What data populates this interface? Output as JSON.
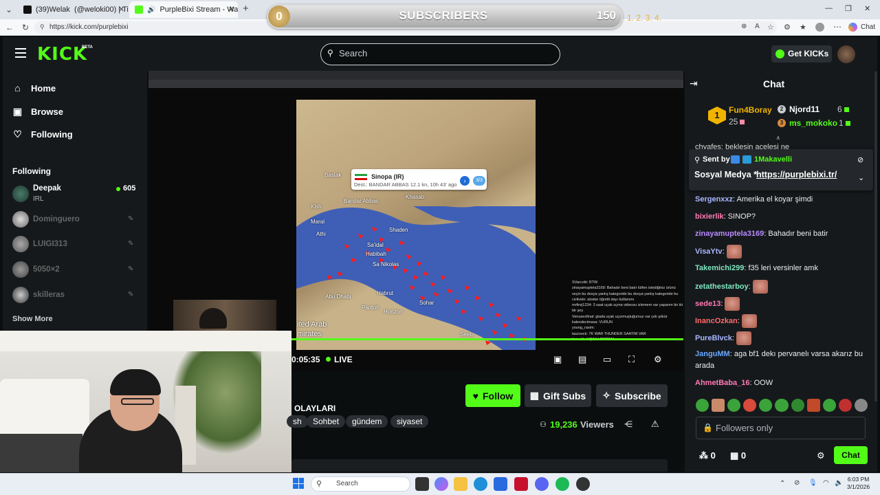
{
  "browser": {
    "tabs": [
      {
        "label": "(39)Welak",
        "label2": "(@weloki00) | TikTok"
      },
      {
        "label": "PurpleBixi Stream - Watch Live"
      }
    ],
    "url": "https://kick.com/purplebixi",
    "chat_label": "Chat"
  },
  "overlay": {
    "current": "0",
    "title": "SUBSCRIBERS",
    "goal": "150",
    "steps": "1. 2.  3. 4."
  },
  "header": {
    "logo": "KICK",
    "beta": "BETA",
    "search_placeholder": "Search",
    "get_kicks": "Get KICKs"
  },
  "sidebar": {
    "nav": [
      {
        "label": "Home",
        "icon": "home-icon"
      },
      {
        "label": "Browse",
        "icon": "compass-icon"
      },
      {
        "label": "Following",
        "icon": "heart-icon"
      }
    ],
    "following_title": "Following",
    "channels": [
      {
        "name": "Deepak",
        "sub": "IRL",
        "viewers": "605",
        "live": true
      },
      {
        "name": "Dominguero",
        "live": false
      },
      {
        "name": "LUIGI313",
        "live": false
      },
      {
        "name": "5050×2",
        "live": false
      },
      {
        "name": "skilleras",
        "live": false
      }
    ],
    "show_more": "Show More"
  },
  "video": {
    "time": "0:05:35",
    "live_label": "LIVE",
    "tooltip_title": "Sinopa (IR)",
    "tooltip_sub": "Dest.: BANDAR ABBAS  12.1 kn, 10h 43' ago",
    "tooltip_badge": "3/3",
    "map_region": "ited Arab\nmirates",
    "map_labels": [
      "Maral",
      "Athi",
      "Shaden",
      "Habibah",
      "Sa'idal",
      "Sa Nikolas",
      "Abu Dhabi",
      "Parttoh",
      "Habrut",
      "Horizon",
      "Sohar",
      "Seeb",
      "Bandar Abbas",
      "Khasab",
      "Bastak",
      "Kish"
    ],
    "stream_chat": [
      "SVarcotti: BTW",
      "zinayamuptela3169: Bahadır beni batır lütfen istediğiniz ürünü seçin bu dosya yanlış kategoride bu dosya yanlış kategoride bu",
      "civilvele: aloske öğretti dayı kullanımı",
      "mrfirej1234: 3 saat uçak uçma videosu izlemem var yaparım bir iki bir şey",
      "Venusexfinal: gtada uçak uçurmuşluğumuz var çok şükür",
      "kalesdecimasa: VURUN",
      "young_rasim: ",
      "laszoock: 7K WAR THUNDER SAATIM VAR",
      "bixierlik: UÇAK VERİRIM"
    ]
  },
  "stream": {
    "title_fragment": "OLAYLARI",
    "tags": [
      "sh",
      "Sohbet",
      "gündem",
      "siyaset"
    ],
    "follow": "Follow",
    "gift_subs": "Gift Subs",
    "subscribe": "Subscribe",
    "viewers": "19,236",
    "viewers_label": "Viewers"
  },
  "chat": {
    "title": "Chat",
    "leaderboard": [
      {
        "rank": "1",
        "name": "Fun4Boray",
        "value": "25"
      },
      {
        "rank": "2",
        "name": "Njord11",
        "value": "6"
      },
      {
        "rank": "3",
        "name": "ms_mokoko",
        "value": "1"
      }
    ],
    "cut_line": "chyafes: beklesin acelesi ne",
    "pinned": {
      "sent_by": "Sent by",
      "user": "1Makavelli",
      "message": "Sosyal Medya *",
      "link": "https://purplebixi.tr/"
    },
    "messages": [
      {
        "user": "Sergenxxz",
        "text": "Amerika el koyar şimdi",
        "color": "#a8b6ff",
        "emote": false
      },
      {
        "user": "bixierlik",
        "text": "SINOP?",
        "color": "#ff7ab5",
        "emote": false
      },
      {
        "user": "zinayamuptela3169",
        "text": "Bahadır beni batir",
        "color": "#b98aff",
        "emote": false
      },
      {
        "user": "VisaYtv",
        "text": "",
        "color": "#a8b6ff",
        "emote": true
      },
      {
        "user": "Takemichi299",
        "text": "f35 leri versinler amk",
        "color": "#7ee8c0",
        "emote": false
      },
      {
        "user": "zetathestarboy",
        "text": "",
        "color": "#7ee8c0",
        "emote": true
      },
      {
        "user": "sede13",
        "text": "",
        "color": "#ff7ab5",
        "emote": true
      },
      {
        "user": "InancOzkan",
        "text": "",
        "color": "#ff6a6a",
        "emote": true
      },
      {
        "user": "PureBlvck",
        "text": "",
        "color": "#a8b6ff",
        "emote": true
      },
      {
        "user": "JanguMM",
        "text": "aga bf1 dekı pervanelı varsa akarız bu arada",
        "color": "#6aa8ff",
        "emote": false
      },
      {
        "user": "AhmetBaba_16",
        "text": "OOW",
        "color": "#ff7ab5",
        "emote": false
      }
    ],
    "input_placeholder": "Followers only",
    "points": "0",
    "gifts": "0",
    "send": "Chat"
  },
  "taskbar": {
    "search": "Search",
    "time": "6:03 PM",
    "date": "3/1/2026"
  },
  "colors": {
    "kick_green": "#53fc18",
    "bg": "#0b0e0f",
    "panel": "#16191c",
    "gold": "#f0b400"
  }
}
